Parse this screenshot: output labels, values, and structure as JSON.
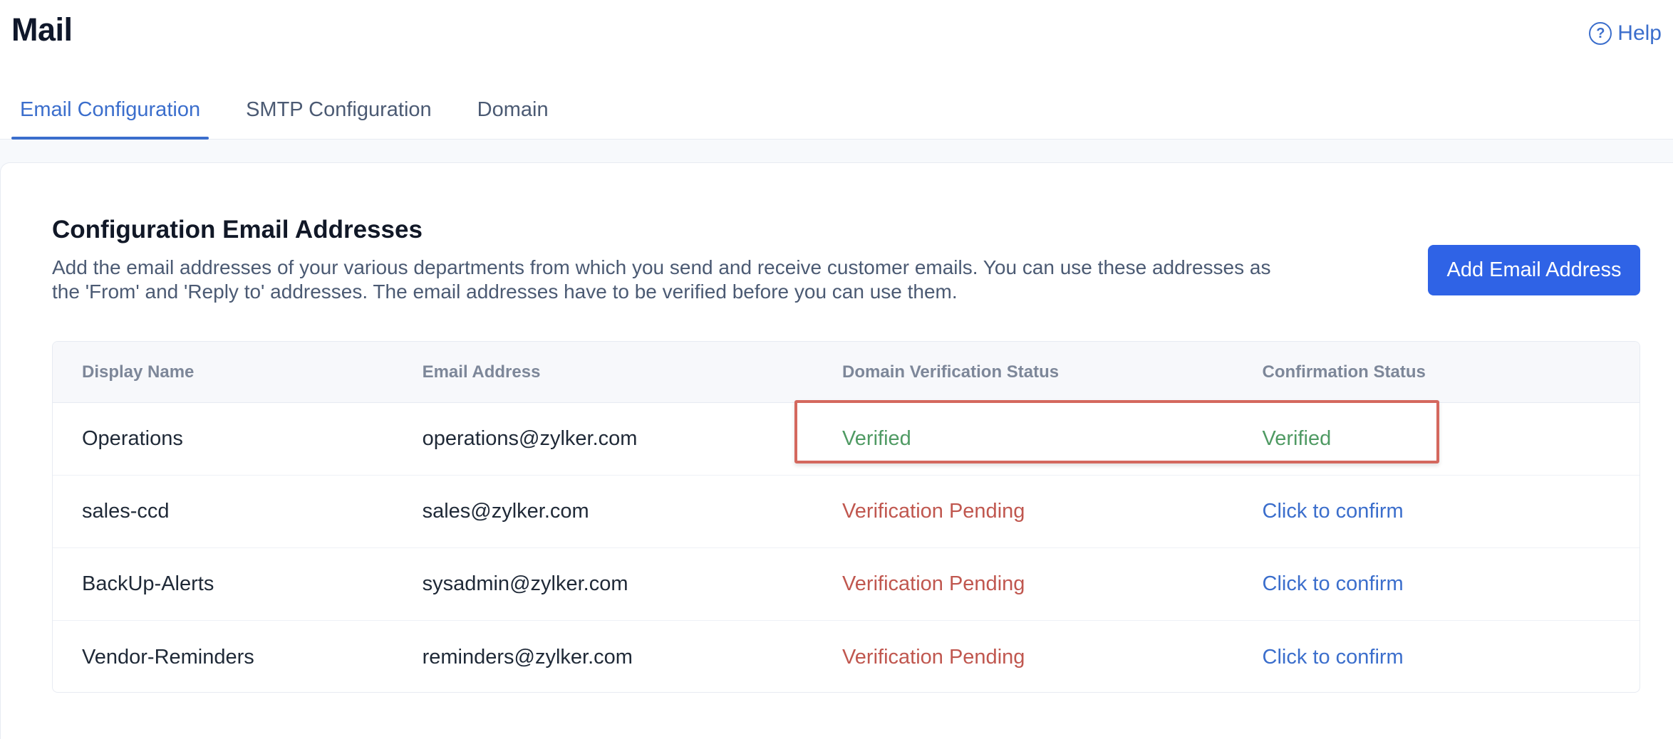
{
  "header": {
    "title": "Mail",
    "help_label": "Help",
    "help_icon": "question-circle-icon"
  },
  "tabs": [
    {
      "label": "Email Configuration",
      "active": true
    },
    {
      "label": "SMTP Configuration",
      "active": false
    },
    {
      "label": "Domain",
      "active": false
    }
  ],
  "section": {
    "title": "Configuration Email Addresses",
    "description": "Add the email addresses of your various departments from which you send and receive customer emails. You can use these addresses as the 'From' and 'Reply to' addresses. The email addresses have to be verified before you can use them.",
    "add_button": "Add Email Address"
  },
  "table": {
    "columns": [
      "Display Name",
      "Email Address",
      "Domain Verification Status",
      "Confirmation Status"
    ],
    "rows": [
      {
        "display_name": "Operations",
        "email": "operations@zylker.com",
        "domain_status": "Verified",
        "confirmation": "Verified"
      },
      {
        "display_name": "sales-ccd",
        "email": "sales@zylker.com",
        "domain_status": "Verification Pending",
        "confirmation": "Click to confirm"
      },
      {
        "display_name": "BackUp-Alerts",
        "email": "sysadmin@zylker.com",
        "domain_status": "Verification Pending",
        "confirmation": "Click to confirm"
      },
      {
        "display_name": "Vendor-Reminders",
        "email": "reminders@zylker.com",
        "domain_status": "Verification Pending",
        "confirmation": "Click to confirm"
      }
    ]
  },
  "colors": {
    "accent": "#3b6ecc",
    "button": "#2f63e6",
    "verified": "#4f9a63",
    "pending": "#c0574f",
    "highlight": "#d4685e"
  }
}
